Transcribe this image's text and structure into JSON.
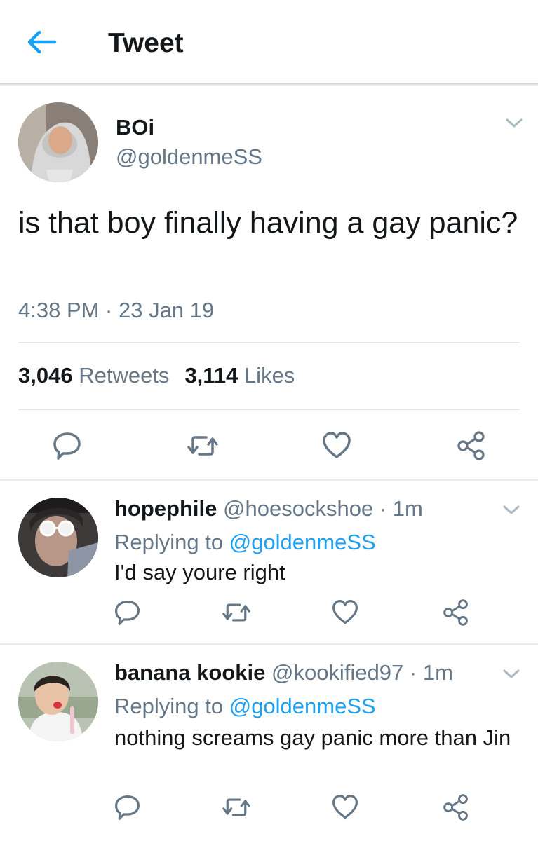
{
  "header": {
    "title": "Tweet",
    "back_icon": "arrow-left-icon",
    "accent": "#1da1f2"
  },
  "main_tweet": {
    "name": "BOi",
    "handle": "@goldenmeSS",
    "text": "is that boy finally having a gay panic?",
    "timestamp": "4:38 PM · 23 Jan 19",
    "retweets_count": "3,046",
    "retweets_label": "Retweets",
    "likes_count": "3,114",
    "likes_label": "Likes"
  },
  "replies": [
    {
      "name": "hopephile",
      "handle": "@hoesockshoe",
      "time": "· 1m",
      "replying_prefix": "Replying to",
      "replying_to": "@goldenmeSS",
      "text": "I'd say youre right"
    },
    {
      "name": "banana kookie",
      "handle": "@kookified97",
      "time": "· 1m",
      "replying_prefix": "Replying to",
      "replying_to": "@goldenmeSS",
      "text": "nothing screams gay panic more than Jin"
    }
  ],
  "colors": {
    "text": "#14171a",
    "secondary": "#657786",
    "link": "#1da1f2",
    "divider": "#e1e8ed"
  }
}
